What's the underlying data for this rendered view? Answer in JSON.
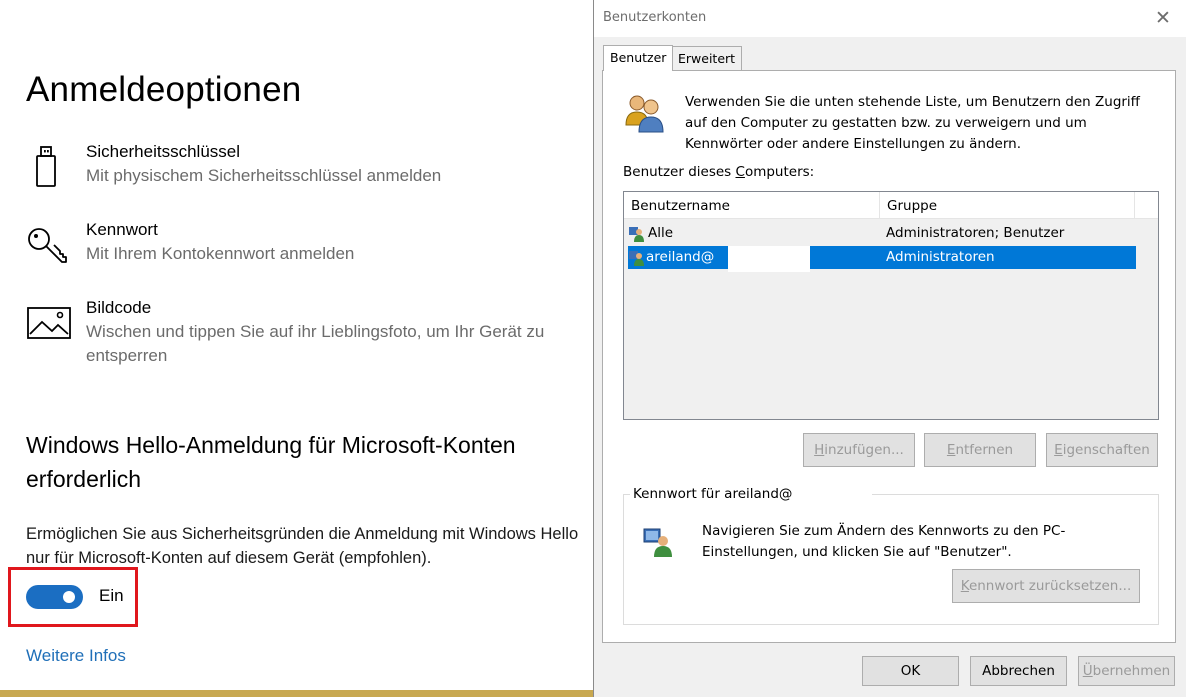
{
  "settings": {
    "page_title": "Anmeldeoptionen",
    "options": [
      {
        "name": "Sicherheitsschlüssel",
        "description": "Mit physischem Sicherheitsschlüssel anmelden",
        "icon": "usb-key-icon"
      },
      {
        "name": "Kennwort",
        "description": "Mit Ihrem Kontokennwort anmelden",
        "icon": "key-icon"
      },
      {
        "name": "Bildcode",
        "description": "Wischen und tippen Sie auf ihr Lieblingsfoto, um Ihr Gerät zu entsperren",
        "icon": "picture-icon"
      }
    ],
    "hello_section": {
      "title": "Windows Hello-Anmeldung für Microsoft-Konten erforderlich",
      "description": "Ermöglichen Sie aus Sicherheitsgründen die Anmeldung mit Windows Hello nur für Microsoft-Konten auf diesem Gerät (empfohlen).",
      "toggle_state": "on",
      "toggle_label": "Ein"
    },
    "more_info_link": "Weitere Infos"
  },
  "dialog": {
    "title": "Benutzerkonten",
    "close_glyph": "✕",
    "tabs": [
      {
        "label": "Benutzer",
        "active": true
      },
      {
        "label": "Erweitert",
        "active": false
      }
    ],
    "intro_text": "Verwenden Sie die unten stehende Liste, um Benutzern den Zugriff auf den Computer zu gestatten bzw. zu verweigern und um Kennwörter oder andere Einstellungen zu ändern.",
    "users_label_pre": "Benutzer dieses ",
    "users_label_accel": "C",
    "users_label_post": "omputers:",
    "columns": [
      "Benutzername",
      "Gruppe"
    ],
    "users": [
      {
        "name": "Alle",
        "group": "Administratoren; Benutzer",
        "selected": false
      },
      {
        "name": "areiland@",
        "group": "Administratoren",
        "selected": true
      }
    ],
    "buttons": {
      "add": {
        "accel": "H",
        "rest": "inzufügen..."
      },
      "remove": {
        "accel": "E",
        "rest": "ntfernen"
      },
      "properties": {
        "accel": "E",
        "rest": "igenschaften"
      }
    },
    "password_group": {
      "legend": "Kennwort für areiland@",
      "text": "Navigieren Sie zum Ändern des Kennworts zu den PC-Einstellungen, und klicken Sie auf \"Benutzer\".",
      "reset_button": {
        "accel": "K",
        "rest": "ennwort zurücksetzen..."
      }
    },
    "footer": {
      "ok": "OK",
      "cancel": "Abbrechen",
      "apply": {
        "accel": "Ü",
        "rest": "bernehmen"
      }
    }
  },
  "colors": {
    "toggle_on": "#1b6ec2",
    "link": "#1f6fb8",
    "highlight_box": "#e0171d",
    "selection": "#0078d7"
  }
}
